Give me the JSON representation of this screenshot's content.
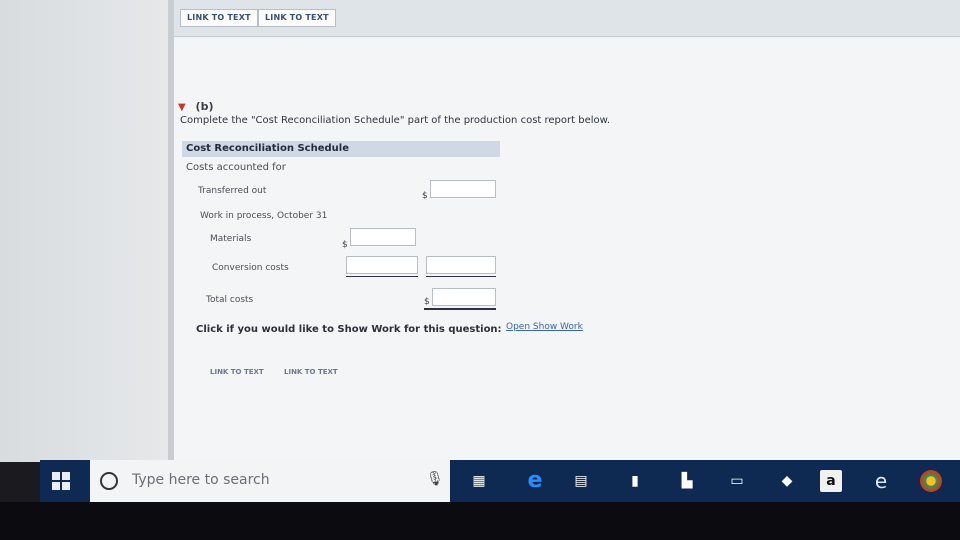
{
  "top_links": [
    "LINK TO TEXT",
    "LINK TO TEXT"
  ],
  "section": {
    "marker": "(b)",
    "instruction": "Complete the \"Cost Reconciliation Schedule\" part of the production cost report below."
  },
  "schedule": {
    "header": "Cost Reconciliation Schedule",
    "subheader": "Costs accounted for",
    "transferred_out": "Transferred out",
    "wip_label": "Work in process, October 31",
    "materials": "Materials",
    "conversion": "Conversion costs",
    "total": "Total costs",
    "currency": "$"
  },
  "show_work": {
    "prompt": "Click if you would like to Show Work for this question:",
    "link": "Open Show Work"
  },
  "bottom_links": [
    "LINK TO TEXT",
    "LINK TO TEXT"
  ],
  "taskbar": {
    "search_placeholder": "Type here to search"
  },
  "colors": {
    "taskbar": "#0f2a52",
    "accent_link": "#3b63b3",
    "caret": "#c0392b"
  }
}
